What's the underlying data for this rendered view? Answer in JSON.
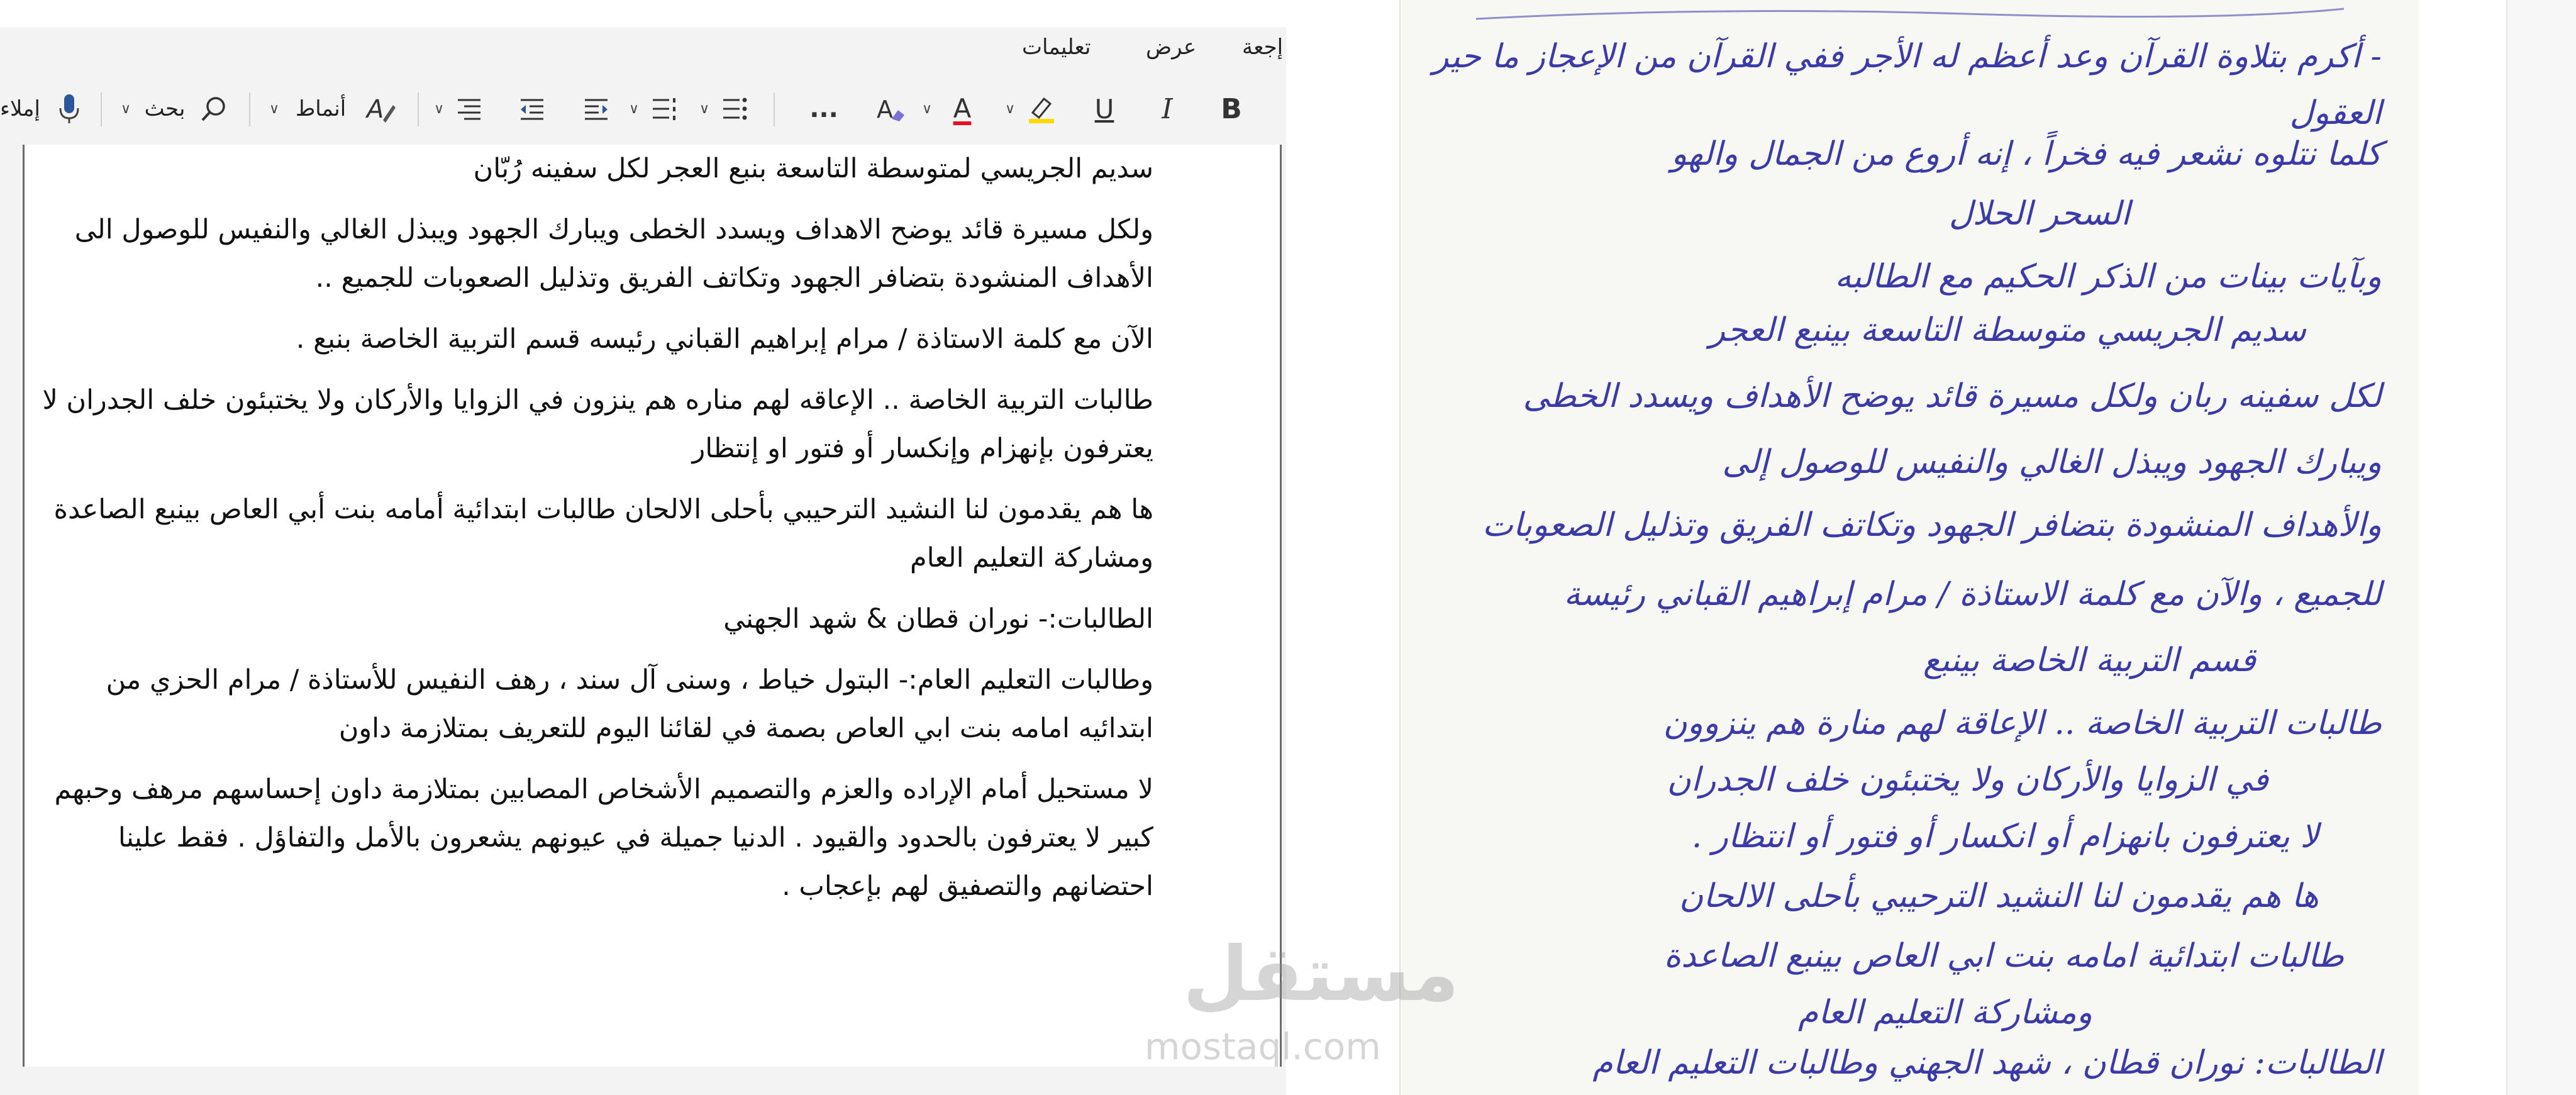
{
  "menu": {
    "items": [
      {
        "label": "تعليمات"
      },
      {
        "label": "عرض"
      },
      {
        "label": "إجعة"
      }
    ]
  },
  "toolbar": {
    "bold_label": "B",
    "italic_label": "I",
    "underline_label": "U",
    "font_color_label": "A",
    "more_label": "...",
    "styles_label": "أنماط",
    "search_label": "بحث",
    "dictate_label": "إملاء",
    "colors": {
      "font_color": "#e81123",
      "highlight": "#ffd800",
      "accent": "#2b579a"
    }
  },
  "document": {
    "paragraphs": [
      "سديم الجريسي لمتوسطة التاسعة بنبع العجر لكل سفينه رُبّان",
      "ولكل مسيرة قائد يوضح الاهداف ويسدد الخطى ويبارك الجهود ويبذل الغالي والنفيس للوصول الى الأهداف المنشودة بتضافر الجهود وتكاتف الفريق وتذليل الصعوبات للجميع ..",
      "الآن مع كلمة الاستاذة / مرام إبراهيم القباني رئيسه قسم التربية الخاصة بنبع .",
      "طالبات التربية الخاصة .. الإعاقه لهم مناره هم ينزون في الزوايا والأركان ولا يختبئون خلف الجدران لا يعترفون بإنهزام وإنكسار أو فتور او إنتظار",
      "ها هم يقدمون لنا النشيد الترحيبي بأحلى الالحان طالبات ابتدائية أمامه بنت أبي العاص بينبع الصاعدة ومشاركة التعليم العام",
      "الطالبات:- نوران قطان & شهد الجهني",
      "وطالبات التعليم العام:- البتول خياط ، وسنى آل سند ، رهف النفيس للأستاذة / مرام الحزي من ابتدائيه امامه بنت ابي العاص بصمة في لقائنا اليوم للتعريف بمتلازمة داون",
      "لا مستحيل أمام الإراده والعزم والتصميم الأشخاص المصابين بمتلازمة داون إحساسهم مرهف وحبهم كبير لا يعترفون بالحدود والقيود . الدنيا جميلة في عيونهم يشعرون بالأمل والتفاؤل . فقط علينا احتضانهم والتصفيق لهم بإعجاب ."
    ]
  },
  "note": {
    "lines": [
      "- أكرم بتلاوة القرآن وعد أعظم له الأجر ففي القرآن من الإعجاز ما حير",
      "العقول",
      "كلما نتلوه نشعر فيه فخراً ، إنه أروع من الجمال والهو",
      "السحر الحلال",
      "وبآيات بينات من الذكر الحكيم مع الطالبه",
      "سديم الجريسي متوسطة التاسعة بينبع العجر",
      "لكل سفينه ربان ولكل مسيرة قائد يوضح الأهداف ويسدد الخطى",
      "ويبارك الجهود ويبذل الغالي والنفيس للوصول إلى",
      "والأهداف المنشودة بتضافر الجهود وتكاتف الفريق وتذليل الصعوبات",
      "للجميع ، والآن مع كلمة الاستاذة / مرام إبراهيم القباني رئيسة",
      "قسم التربية الخاصة بينبع",
      "طالبات التربية الخاصة .. الإعاقة لهم منارة هم ينزوون",
      "في الزوايا والأركان ولا يختبئون خلف الجدران",
      "لا يعترفون بانهزام أو انكسار أو فتور أو انتظار .",
      "ها هم يقدمون لنا النشيد الترحيبي بأحلى الالحان",
      "طالبات ابتدائية امامه بنت ابي العاص بينبع الصاعدة",
      "ومشاركة التعليم العام",
      "الطالبات: نوران قطان ، شهد الجهني وطالبات التعليم العام"
    ]
  },
  "watermark": {
    "arabic": "مستقل",
    "latin": "mostaql.com"
  }
}
